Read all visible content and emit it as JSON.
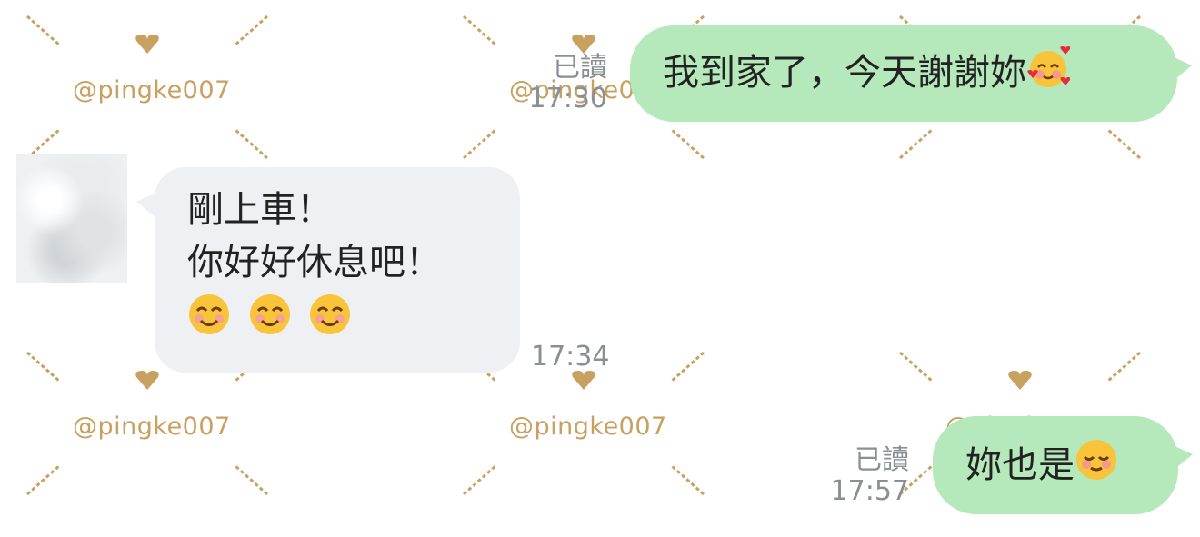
{
  "watermark": {
    "handle": "@pingke007",
    "color": "#c8a060"
  },
  "messages": [
    {
      "id": "m1",
      "side": "out",
      "text": "我到家了，今天謝謝妳",
      "emoji": "smiling-face-with-hearts",
      "read_label": "已讀",
      "time": "17:30"
    },
    {
      "id": "m2",
      "side": "in",
      "lines": [
        "剛上車！",
        "你好好休息吧！"
      ],
      "emojis": [
        "smiling-face-with-smiling-eyes",
        "smiling-face-with-smiling-eyes",
        "smiling-face-with-smiling-eyes"
      ],
      "time": "17:34"
    },
    {
      "id": "m3",
      "side": "out",
      "text": "妳也是",
      "emoji": "relieved-blushing-face",
      "read_label": "已讀",
      "time": "17:57"
    }
  ],
  "colors": {
    "outgoing_bubble": "#b5e8ba",
    "incoming_bubble": "#eef0f3",
    "meta_text": "#8a8f94"
  }
}
